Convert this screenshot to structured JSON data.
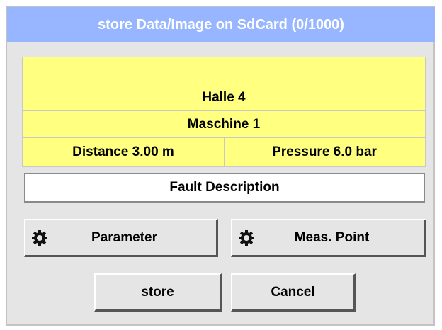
{
  "dialog": {
    "title": "store Data/Image on SdCard (0/1000)"
  },
  "info": {
    "line1": "",
    "line2": "Halle 4",
    "line3": "Maschine 1",
    "distance": "Distance 3.00 m",
    "pressure": "Pressure 6.0 bar"
  },
  "fault": {
    "label": "Fault Description"
  },
  "buttons": {
    "parameter": "Parameter",
    "meas_point": "Meas. Point",
    "store": "store",
    "cancel": "Cancel"
  },
  "icons": {
    "parameter": "gear-icon",
    "meas_point": "gear-icon"
  },
  "colors": {
    "title_bar": "#98b6ff",
    "info_panel": "#ffff80",
    "dialog_bg": "#e5e5e5"
  }
}
